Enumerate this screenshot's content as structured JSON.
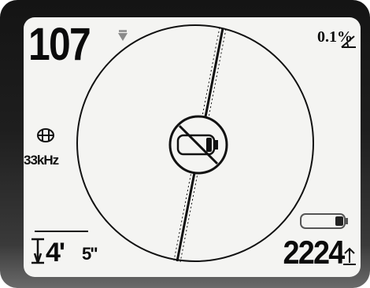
{
  "display": {
    "signal_strength": "107",
    "gain": "0.1%",
    "frequency": "33kHz",
    "depth_feet": "4'",
    "depth_inches": "5\"",
    "current": "2224"
  },
  "icons": {
    "signal_indicator": "down-triangle-icon",
    "gain_icon": "slope-angle-icon",
    "frequency_icon": "antenna-globe-icon",
    "depth_icon": "depth-bracket-icon",
    "current_icon": "current-arrow-icon",
    "center_status": "no-battery-icon",
    "battery": "battery-icon"
  },
  "colors": {
    "bezel": "#1a1a1a",
    "screen": "#f4f4f2",
    "ink": "#0b0b0b"
  }
}
